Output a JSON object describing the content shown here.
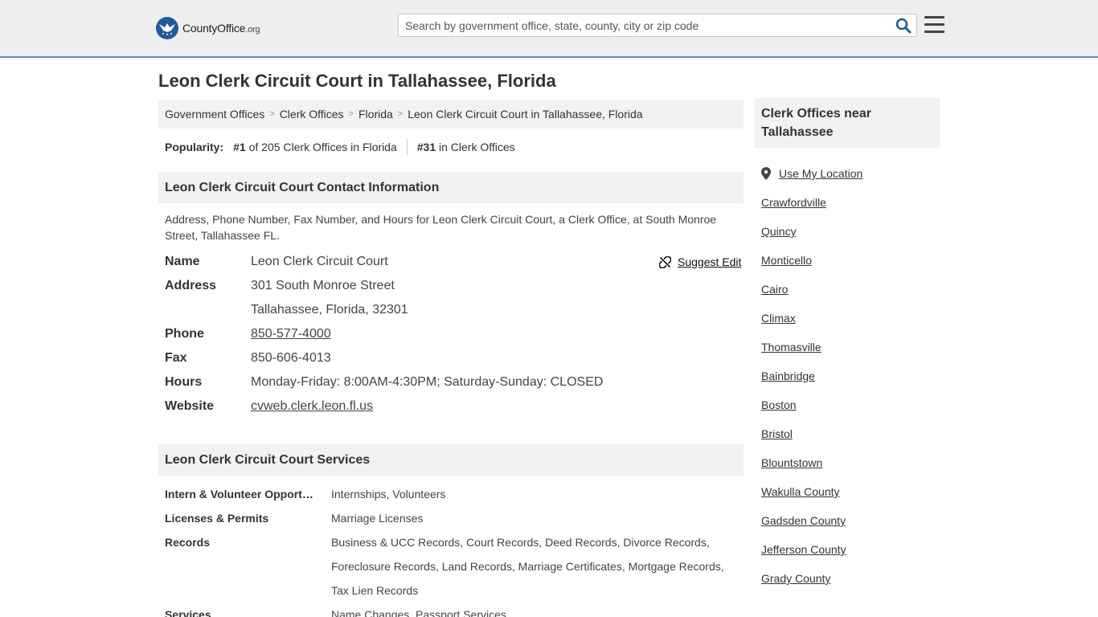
{
  "header": {
    "logo_text": "CountyOffice",
    "logo_tld": ".org",
    "search_placeholder": "Search by government office, state, county, city or zip code"
  },
  "page_title": "Leon Clerk Circuit Court in Tallahassee, Florida",
  "breadcrumb": [
    "Government Offices",
    "Clerk Offices",
    "Florida",
    "Leon Clerk Circuit Court in Tallahassee, Florida"
  ],
  "popularity": {
    "label": "Popularity:",
    "state_rank": "#1",
    "state_text": "of 205 Clerk Offices in Florida",
    "overall_rank": "#31",
    "overall_text": "in Clerk Offices"
  },
  "contact": {
    "heading": "Leon Clerk Circuit Court Contact Information",
    "description": "Address, Phone Number, Fax Number, and Hours for Leon Clerk Circuit Court, a Clerk Office, at South Monroe Street, Tallahassee FL.",
    "suggest_edit": "Suggest Edit",
    "labels": {
      "name": "Name",
      "address": "Address",
      "phone": "Phone",
      "fax": "Fax",
      "hours": "Hours",
      "website": "Website"
    },
    "name": "Leon Clerk Circuit Court",
    "address_line1": "301 South Monroe Street",
    "address_line2": "Tallahassee, Florida, 32301",
    "phone": "850-577-4000",
    "fax": "850-606-4013",
    "hours": "Monday-Friday: 8:00AM-4:30PM; Saturday-Sunday: CLOSED",
    "website": "cvweb.clerk.leon.fl.us"
  },
  "services": {
    "heading": "Leon Clerk Circuit Court Services",
    "rows": [
      {
        "label": "Intern & Volunteer Opportunities",
        "value": "Internships, Volunteers"
      },
      {
        "label": "Licenses & Permits",
        "value": "Marriage Licenses"
      },
      {
        "label": "Records",
        "value": "Business & UCC Records, Court Records, Deed Records, Divorce Records, Foreclosure Records, Land Records, Marriage Certificates, Mortgage Records, Tax Lien Records"
      },
      {
        "label": "Services",
        "value": "Name Changes, Passport Services"
      }
    ]
  },
  "sidebar": {
    "heading": "Clerk Offices near Tallahassee",
    "use_location": "Use My Location",
    "items": [
      "Crawfordville",
      "Quincy",
      "Monticello",
      "Cairo",
      "Climax",
      "Thomasville",
      "Bainbridge",
      "Boston",
      "Bristol",
      "Blountstown",
      "Wakulla County",
      "Gadsden County",
      "Jefferson County",
      "Grady County"
    ]
  },
  "colors": {
    "accent": "#1e5a9c",
    "header_bg": "#eeeeee",
    "header_border": "#5b8ec7",
    "panel_bg": "#f2f2f2"
  }
}
